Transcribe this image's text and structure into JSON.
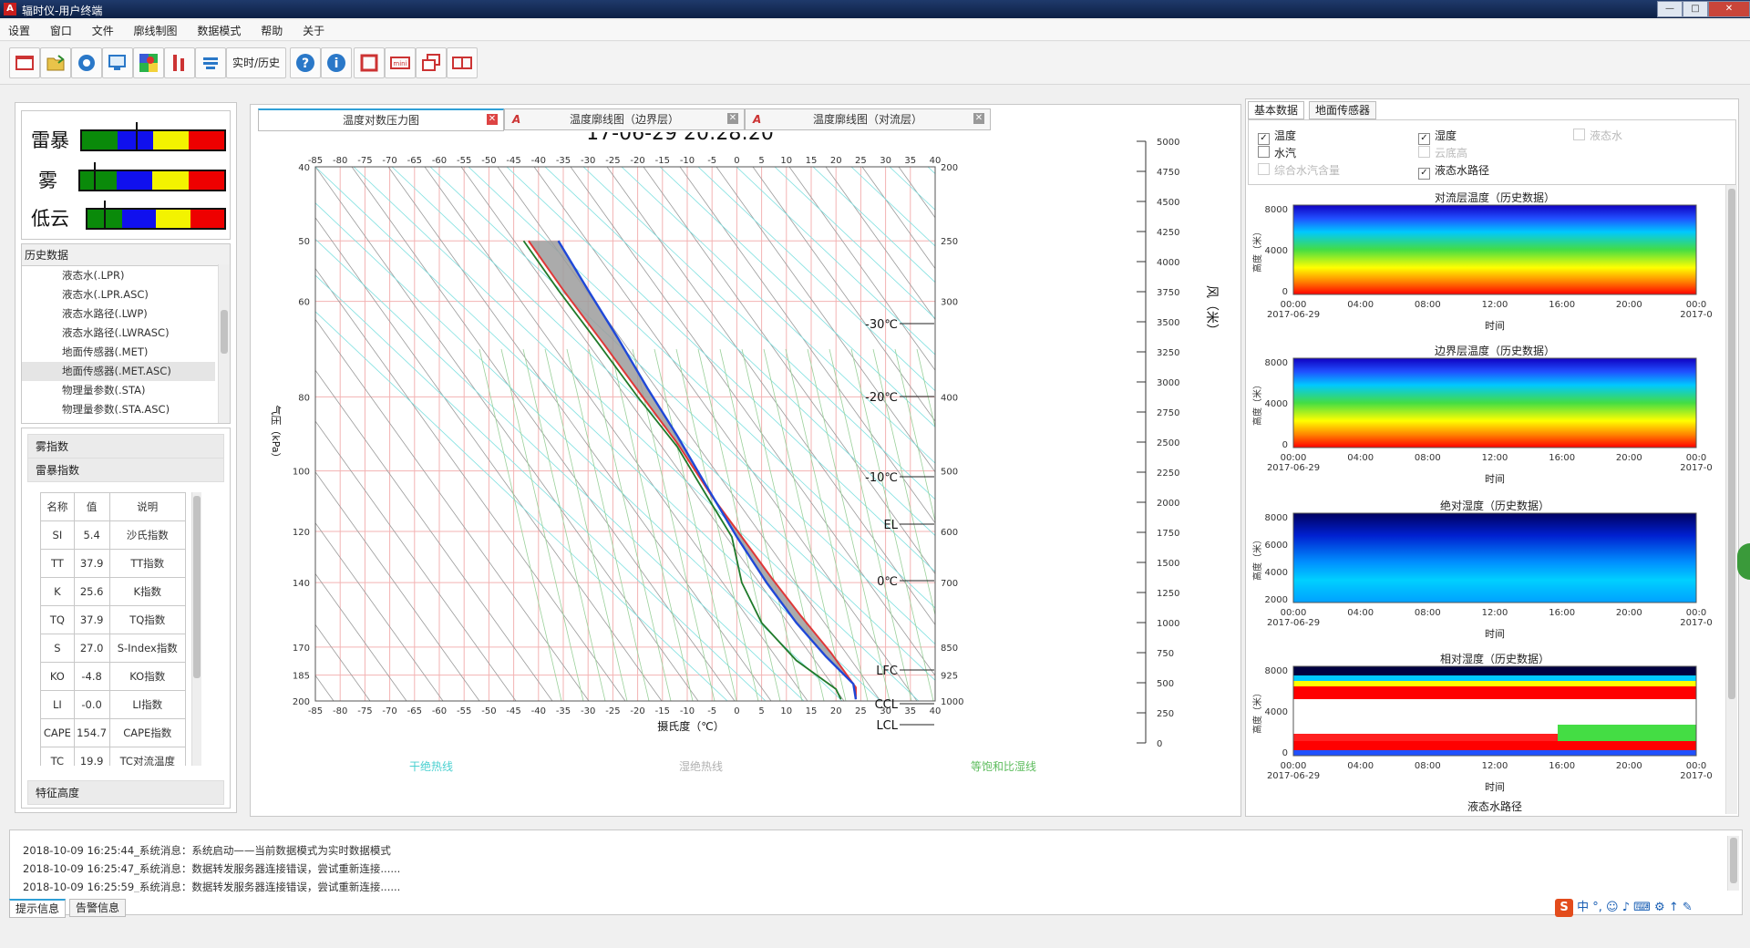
{
  "window": {
    "title": "辐时仪-用户终端"
  },
  "menu": [
    "设置",
    "窗口",
    "文件",
    "廓线制图",
    "数据模式",
    "帮助",
    "关于"
  ],
  "toolbar": {
    "realtime_label": "实时/历史"
  },
  "gauges": [
    {
      "label": "雷暴",
      "needle": 0.39
    },
    {
      "label": "雾",
      "needle": 0.11
    },
    {
      "label": "低云",
      "needle": 0.13
    }
  ],
  "history": {
    "header": "历史数据",
    "items": [
      "液态水(.LPR)",
      "液态水(.LPR.ASC)",
      "液态水路径(.LWP)",
      "液态水路径(.LWRASC)",
      "地面传感器(.MET)",
      "地面传感器(.MET.ASC)",
      "物理量参数(.STA)",
      "物理量参数(.STA.ASC)"
    ],
    "selected_index": 5
  },
  "indices": {
    "sections": [
      "雾指数",
      "雷暴指数"
    ],
    "columns": [
      "名称",
      "值",
      "说明"
    ],
    "rows": [
      [
        "SI",
        "5.4",
        "沙氏指数"
      ],
      [
        "TT",
        "37.9",
        "TT指数"
      ],
      [
        "K",
        "25.6",
        "K指数"
      ],
      [
        "TQ",
        "37.9",
        "TQ指数"
      ],
      [
        "S",
        "27.0",
        "S-Index指数"
      ],
      [
        "KO",
        "-4.8",
        "KO指数"
      ],
      [
        "LI",
        "-0.0",
        "LI指数"
      ],
      [
        "CAPE",
        "154.7",
        "CAPE指数"
      ],
      [
        "TC",
        "19.9",
        "TC对流温度"
      ]
    ],
    "footer": "特征高度"
  },
  "center_tabs": [
    {
      "label": "温度对数压力图",
      "active": true
    },
    {
      "label": "温度廓线图（边界层）",
      "active": false
    },
    {
      "label": "温度廓线图（对流层）",
      "active": false
    }
  ],
  "skewt": {
    "timestamp": "17-06-29  20:28:20",
    "x_axis_label": "摄氏度（℃）",
    "y_axis_label": "气压（kPa）",
    "right_axis_label": "风（米）",
    "temp_ticks": [
      -85,
      -80,
      -75,
      -70,
      -65,
      -60,
      -55,
      -50,
      -45,
      -40,
      -35,
      -30,
      -25,
      -20,
      -15,
      -10,
      -5,
      0,
      5,
      10,
      15,
      20,
      25,
      30,
      35,
      40
    ],
    "left_pressure_ticks": [
      40,
      50,
      60,
      80,
      100,
      120,
      140,
      170,
      185,
      200
    ],
    "right_pressure_ticks": [
      200,
      250,
      300,
      400,
      500,
      600,
      700,
      850,
      925,
      1000
    ],
    "height_ticks": [
      5000,
      4750,
      4500,
      4250,
      4000,
      3750,
      3500,
      3250,
      3000,
      2750,
      2500,
      2250,
      2000,
      1750,
      1500,
      1250,
      1000,
      750,
      500,
      250,
      0
    ],
    "level_labels": [
      "-30℃",
      "-20℃",
      "-10℃",
      "EL",
      "0℃",
      "LFC",
      "CCL",
      "LCL"
    ],
    "legend": [
      "干绝热线",
      "湿绝热线",
      "等饱和比湿线"
    ]
  },
  "right_panel": {
    "tabs": [
      "基本数据",
      "地面传感器"
    ],
    "checkboxes": [
      {
        "label": "温度",
        "checked": true,
        "enabled": true
      },
      {
        "label": "湿度",
        "checked": true,
        "enabled": true
      },
      {
        "label": "液态水",
        "checked": false,
        "enabled": false
      },
      {
        "label": "水汽",
        "checked": false,
        "enabled": true
      },
      {
        "label": "云底高",
        "checked": false,
        "enabled": false
      },
      {
        "label": "综合水汽含量",
        "checked": false,
        "enabled": false
      },
      {
        "label": "液态水路径",
        "checked": true,
        "enabled": true
      }
    ],
    "plots": [
      {
        "title": "对流层温度（历史数据）",
        "yticks": [
          "8000",
          "4000",
          "0"
        ]
      },
      {
        "title": "边界层温度（历史数据）",
        "yticks": [
          "8000",
          "4000",
          "0"
        ]
      },
      {
        "title": "绝对湿度（历史数据）",
        "yticks": [
          "8000",
          "6000",
          "4000",
          "2000"
        ]
      },
      {
        "title": "相对湿度（历史数据）",
        "yticks": [
          "8000",
          "4000",
          "0"
        ]
      }
    ],
    "xticks": [
      "00:00",
      "04:00",
      "08:00",
      "12:00",
      "16:00",
      "20:00",
      "00:0"
    ],
    "date_left": "2017-06-29",
    "date_right": "2017-0",
    "xlabel": "时间",
    "ylabel": "高度（米）",
    "bottom_title": "液态水路径"
  },
  "log": {
    "lines": [
      "2018-10-09 16:25:44_系统消息：系统启动——当前数据模式为实时数据模式",
      "2018-10-09 16:25:47_系统消息：数据转发服务器连接错误，尝试重新连接......",
      "2018-10-09 16:25:59_系统消息：数据转发服务器连接错误，尝试重新连接......"
    ],
    "tabs": [
      "提示信息",
      "告警信息"
    ]
  }
}
